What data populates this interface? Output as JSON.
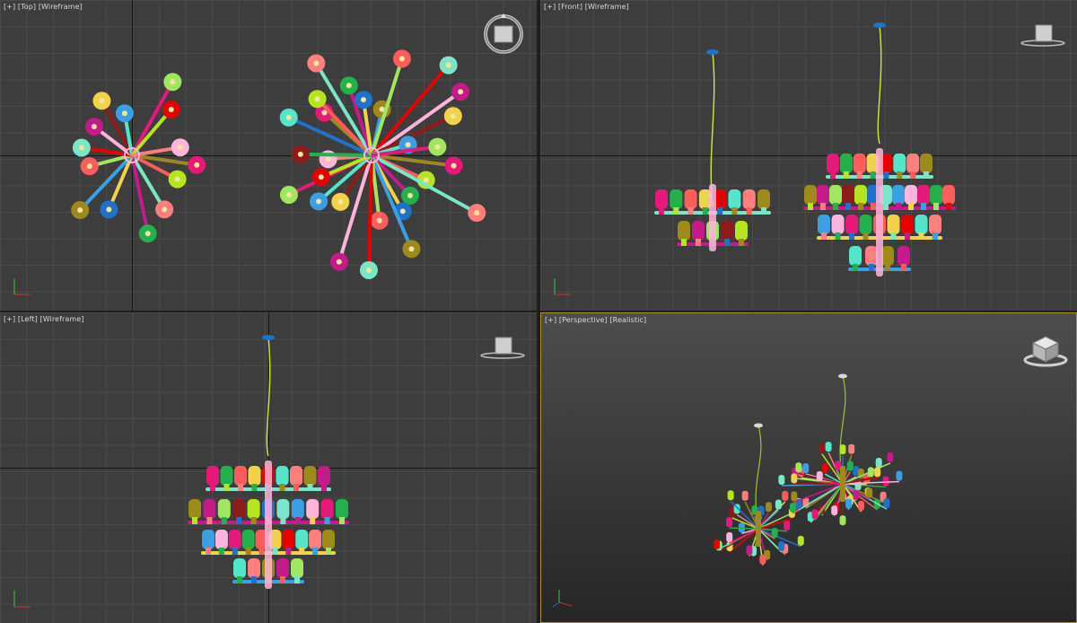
{
  "viewports": {
    "top": {
      "menu": "[+]",
      "view": "[Top]",
      "shading": "[Wireframe]"
    },
    "front": {
      "menu": "[+]",
      "view": "[Front]",
      "shading": "[Wireframe]"
    },
    "left": {
      "menu": "[+]",
      "view": "[Left]",
      "shading": "[Wireframe]"
    },
    "persp": {
      "menu": "[+]",
      "view": "[Perspective]",
      "shading": "[Realistic]"
    }
  },
  "colors": {
    "viewport_bg": "#3d3d3d",
    "grid_line": "#4a4a4a",
    "active_border": "#a8913a",
    "palette": [
      "#e6197a",
      "#b5e61d",
      "#ff7f7f",
      "#22b14c",
      "#1e72c8",
      "#9e8a1a",
      "#ff5c5c",
      "#7ae6c8",
      "#c51a8a",
      "#f0d34a",
      "#3aa0e6",
      "#a0e660",
      "#e60000",
      "#ffb4dc",
      "#8f1a1a",
      "#54e6c8"
    ]
  },
  "icons": {
    "viewcube": "viewcube-icon",
    "compass": "compass-ring-icon",
    "axis_gizmo": "xyz-axis-gizmo-icon"
  }
}
